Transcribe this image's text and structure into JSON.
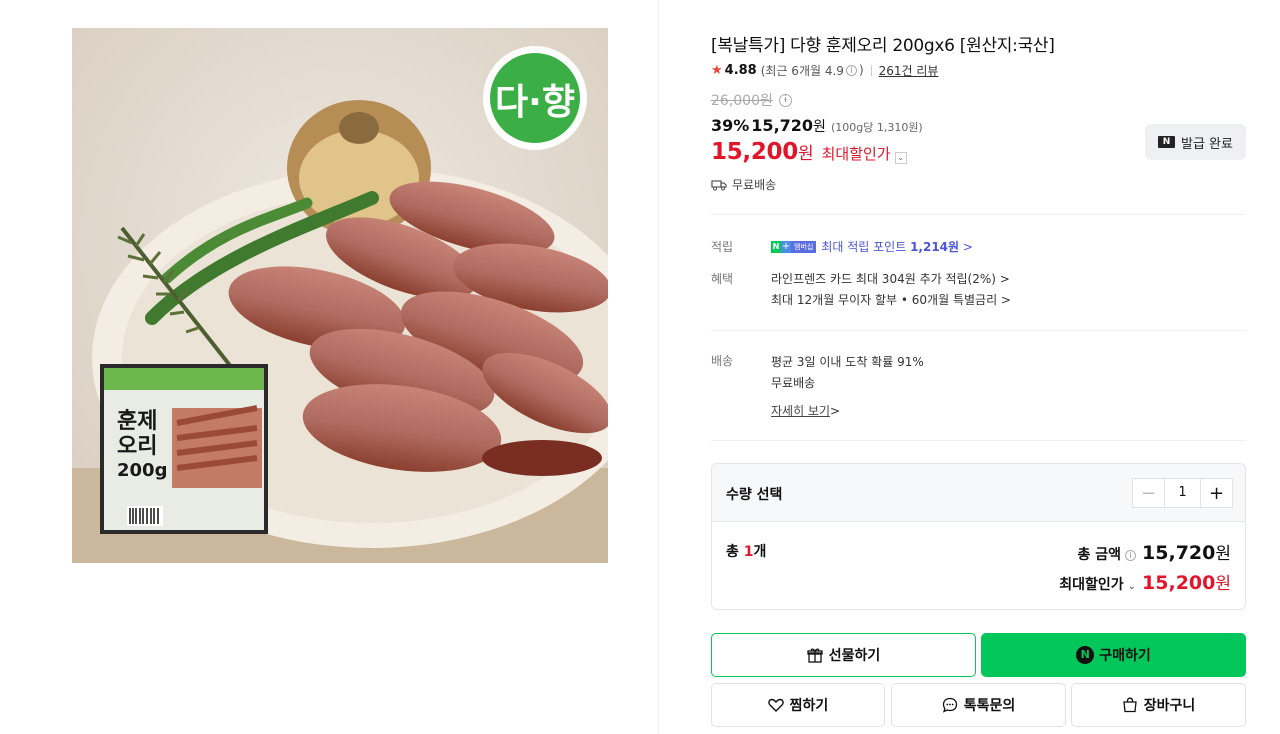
{
  "product": {
    "title": "[복날특가] 다향 훈제오리 200gx6 [원산지:국산]",
    "image_logo": "다·향",
    "package_text": "훈제\n오리\n200g"
  },
  "rating": {
    "star_icon": "star-icon",
    "score": "4.88",
    "recent": "(최근 6개월 4.9",
    "recent_close": ")",
    "reviews": "261건 리뷰"
  },
  "price": {
    "original": "26,000원",
    "discount_pct": "39%",
    "discounted": "15,720",
    "discounted_unit": "원",
    "per_unit": "(100g당 1,310원)",
    "max_price": "15,200",
    "max_won": "원",
    "max_label": "최대할인가"
  },
  "coupon": {
    "label": "발급 완료",
    "badge": "N"
  },
  "shipping": {
    "label": "무료배송"
  },
  "points": {
    "label": "적립",
    "badge_n": "N",
    "badge_plus": "+",
    "badge_member": "멤버십",
    "text": "최대 적립 포인트 ",
    "amount": "1,214원",
    "chev": " >"
  },
  "benefits": {
    "label": "혜택",
    "line1": "라인프렌즈 카드 최대 304원 추가 적립(2%) >",
    "line2": "최대 12개월 무이자 할부 • 60개월 특별금리 >"
  },
  "delivery": {
    "label": "배송",
    "line1": "평균 3일 이내 도착 확률 91%",
    "line2": "무료배송",
    "detail": "자세히 보기",
    "detail_chev": " >"
  },
  "quantity": {
    "title": "수량 선택",
    "minus": "−",
    "value": "1",
    "plus": "+",
    "total_prefix": "총 ",
    "total_count": "1",
    "total_suffix": "개",
    "total_label": "총 금액",
    "total_value": "15,720",
    "total_won": "원",
    "max_label": "최대할인가",
    "max_value": "15,200",
    "max_won": "원"
  },
  "actions": {
    "gift": "선물하기",
    "buy": "구매하기",
    "buy_badge": "N",
    "wish": "찜하기",
    "talk": "톡톡문의",
    "cart": "장바구니"
  },
  "colors": {
    "brand_green": "#03c75a",
    "sale_red": "#e0162b",
    "points_blue": "#4b53d6"
  }
}
